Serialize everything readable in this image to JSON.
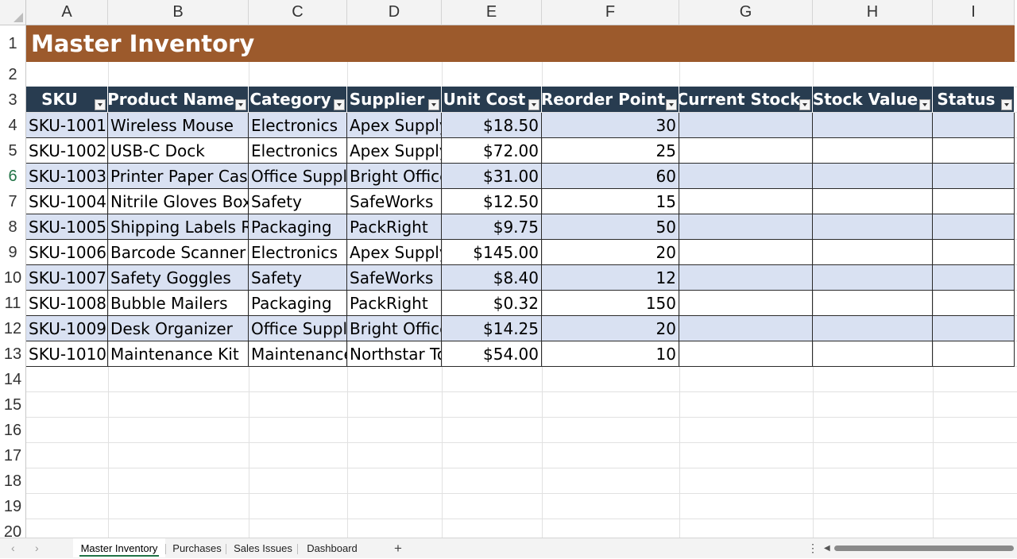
{
  "columns": [
    "A",
    "B",
    "C",
    "D",
    "E",
    "F",
    "G",
    "H",
    "I"
  ],
  "rows": [
    "1",
    "2",
    "3",
    "4",
    "5",
    "6",
    "7",
    "8",
    "9",
    "10",
    "11",
    "12",
    "13",
    "14",
    "15",
    "16",
    "17",
    "18",
    "19",
    "20"
  ],
  "title": "Master Inventory",
  "headers": [
    "SKU",
    "Product Name",
    "Category",
    "Supplier",
    "Unit Cost",
    "Reorder Point",
    "Current Stock",
    "Stock Value",
    "Status"
  ],
  "data": [
    [
      "SKU-1001",
      "Wireless Mouse",
      "Electronics",
      "Apex Supply",
      "$18.50",
      "30"
    ],
    [
      "SKU-1002",
      "USB-C Dock",
      "Electronics",
      "Apex Supply",
      "$72.00",
      "25"
    ],
    [
      "SKU-1003",
      "Printer Paper Case",
      "Office Suppli",
      "Bright Office",
      "$31.00",
      "60"
    ],
    [
      "SKU-1004",
      "Nitrile Gloves Box",
      "Safety",
      "SafeWorks",
      "$12.50",
      "15"
    ],
    [
      "SKU-1005",
      "Shipping Labels Ro",
      "Packaging",
      "PackRight",
      "$9.75",
      "50"
    ],
    [
      "SKU-1006",
      "Barcode Scanner",
      "Electronics",
      "Apex Supply",
      "$145.00",
      "20"
    ],
    [
      "SKU-1007",
      "Safety Goggles",
      "Safety",
      "SafeWorks",
      "$8.40",
      "12"
    ],
    [
      "SKU-1008",
      "Bubble Mailers",
      "Packaging",
      "PackRight",
      "$0.32",
      "150"
    ],
    [
      "SKU-1009",
      "Desk Organizer",
      "Office Suppli",
      "Bright Office",
      "$14.25",
      "20"
    ],
    [
      "SKU-1010",
      "Maintenance Kit",
      "Maintenance",
      "Northstar To",
      "$54.00",
      "10"
    ]
  ],
  "sheets": [
    "Master Inventory",
    "Purchases",
    "Sales Issues",
    "Dashboard"
  ],
  "active_sheet": "Master Inventory",
  "add_sheet_glyph": "+",
  "more_glyph": "⋮",
  "nav_prev_glyph": "‹",
  "nav_next_glyph": "›",
  "scroll_left_glyph": "◀",
  "colors": {
    "title_bg": "#9c5a2c",
    "header_bg": "#283c50",
    "band": "#d9e1f2",
    "accent": "#217346"
  },
  "icons": [
    "filter-dropdown-icon",
    "add-sheet-icon",
    "more-options-icon",
    "scroll-left-icon"
  ]
}
